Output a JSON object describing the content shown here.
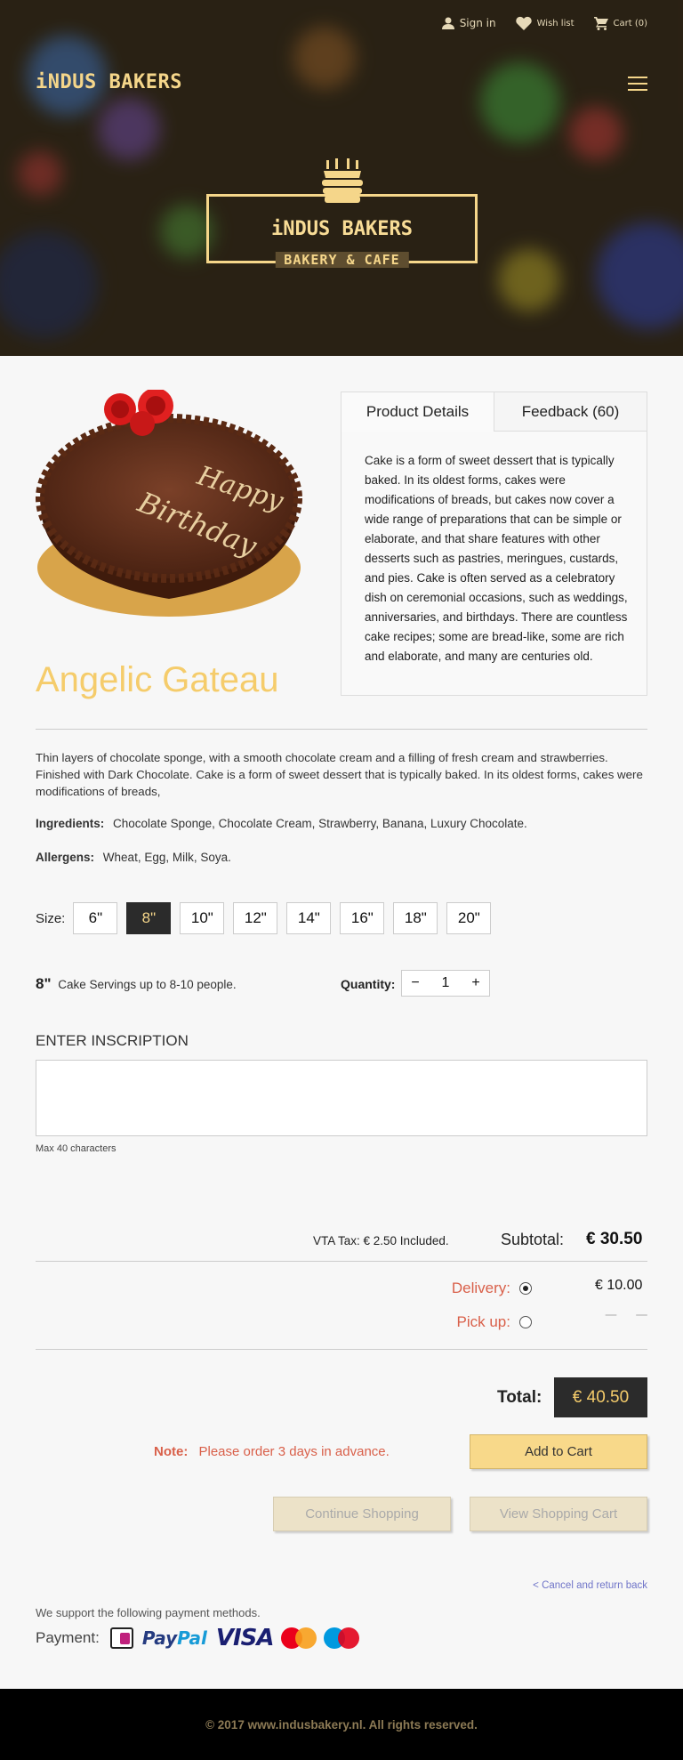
{
  "topnav": {
    "sign_in": "Sign in",
    "wish_list": "Wish list",
    "cart": "Cart (0)"
  },
  "brand": "iNDUS BAKERS",
  "logo": {
    "title": "iNDUS BAKERS",
    "subtitle": "BAKERY & CAFE"
  },
  "product": {
    "name": "Angelic Gateau",
    "tabs": [
      {
        "label": "Product Details",
        "active": true
      },
      {
        "label": "Feedback (60)",
        "active": false
      }
    ],
    "details": "Cake is a form of sweet dessert that is typically baked. In its oldest forms, cakes were modifications of breads, but cakes now cover a wide range of preparations that can be simple or elaborate, and that share features with other desserts such as pastries, meringues, custards, and pies. Cake is often served as a celebratory dish on ceremonial occasions, such as weddings, anniversaries, and birthdays. There are countless cake recipes; some are bread-like, some are rich and elaborate, and many are centuries old.",
    "description": "Thin layers of chocolate sponge, with a smooth chocolate cream and a filling of fresh cream and strawberries. Finished with Dark Chocolate. Cake is a form of sweet dessert that is typically baked. In its oldest forms, cakes were modifications of breads,",
    "ingredients_label": "Ingredients:",
    "ingredients": "Chocolate Sponge, Chocolate Cream, Strawberry, Banana, Luxury Chocolate.",
    "allergens_label": "Allergens:",
    "allergens": "Wheat, Egg, Milk, Soya."
  },
  "sizes": {
    "label": "Size:",
    "options": [
      "6\"",
      "8\"",
      "10\"",
      "12\"",
      "14\"",
      "16\"",
      "18\"",
      "20\""
    ],
    "selected": "8\""
  },
  "servings": {
    "size": "8\"",
    "text": "Cake Servings up to 8-10 people."
  },
  "quantity": {
    "label": "Quantity:",
    "minus": "−",
    "value": "1",
    "plus": "+"
  },
  "inscription": {
    "title": "ENTER INSCRIPTION",
    "value": "",
    "note": "Max 40 characters"
  },
  "pricing": {
    "tax": "VTA Tax: € 2.50 Included.",
    "subtotal_label": "Subtotal:",
    "subtotal": "€ 30.50",
    "delivery_label": "Delivery:",
    "delivery_value": "€ 10.00",
    "pickup_label": "Pick up:",
    "pickup_value": "— —",
    "delivery_selected": true,
    "total_label": "Total:",
    "total": "€ 40.50"
  },
  "note": {
    "label": "Note:",
    "text": "Please order 3 days in advance."
  },
  "buttons": {
    "add_to_cart": "Add to Cart",
    "continue": "Continue Shopping",
    "view_cart": "View Shopping Cart",
    "cancel": "< Cancel and return back"
  },
  "payment": {
    "support": "We support the following payment methods.",
    "label": "Payment:",
    "paypal_a": "Pay",
    "paypal_b": "Pal",
    "visa": "VISA"
  },
  "footer": "© 2017 www.indusbakery.nl. All rights reserved.",
  "colors": {
    "accent_gold": "#f5cc6b",
    "note_red": "#d9604a",
    "dark": "#2b2b2b",
    "link": "#6f74c8"
  },
  "icons": [
    "user-icon",
    "heart-icon",
    "cart-icon",
    "hamburger-icon",
    "cake-logo-icon",
    "radio-icon",
    "ideal-icon",
    "paypal-icon",
    "visa-icon",
    "mastercard-icon",
    "maestro-icon"
  ]
}
